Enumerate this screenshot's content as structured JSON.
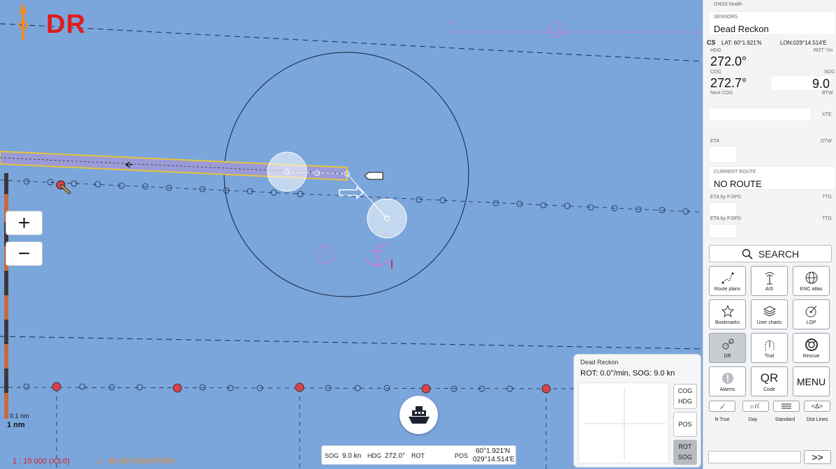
{
  "map": {
    "mode_label": "DR",
    "zoom_in": "+",
    "zoom_out": "−",
    "scale_small": "0.1 nm",
    "scale_big": "1 nm",
    "scale_ratio_main": "1 : 15 000 (X3.0)",
    "scale_ratio_chart": "1 : 45 000  RU4NTKR9",
    "colors": {
      "sea": "#7aa6dc",
      "dr_red": "#e01c1c",
      "orange": "#f08a22",
      "magenta": "#c77ad8",
      "route_fill": "#9a9bd8",
      "route_edge": "#e6c33a"
    }
  },
  "nav_strip": {
    "sog_label": "SOG",
    "sog_value": "9.0 kn",
    "hdg_label": "HDG",
    "hdg_value": "272.0°",
    "rot_label": "ROT",
    "rot_value": "",
    "pos_label": "POS",
    "pos_lat": "60°1.921'N",
    "pos_lon": "029°14.514'E"
  },
  "dr_panel": {
    "title": "Dead Reckon",
    "info": "ROT: 0.0°/min, SOG: 9.0 kn",
    "btn_cog": "COG",
    "btn_hdg": "HDG",
    "btn_pos": "POS",
    "btn_rot": "ROT",
    "btn_sog": "SOG"
  },
  "panel": {
    "gnss": "GNSS health",
    "sensors_label": "SENSORS",
    "sensor_value": "Dead Reckon",
    "cs": "CS",
    "lat": "LAT: 60°1.921'N",
    "lon": "LON:029°14.514'E",
    "hdg_label": "HDG",
    "hdg_value": "272.0°",
    "rot_label": "ROT °/m",
    "cog_label": "COG",
    "cog_value": "272.7°",
    "sog_label": "SOG",
    "sog_value": "9.0",
    "next_cog": "Next COG",
    "btw": "BTW",
    "xte": "XTE",
    "eta": "ETA",
    "dtw": "DTW",
    "current_route_label": "CURRENT ROUTE",
    "current_route_value": "NO ROUTE",
    "eta_pspd_1": "ETA by P.SPD",
    "ttg_1": "TTG",
    "eta_pspd_2": "ETA by P.SPD",
    "ttg_2": "TTG",
    "search": "SEARCH",
    "buttons": [
      {
        "label": "Route plans"
      },
      {
        "label": "AIS"
      },
      {
        "label": "ENC atlas"
      },
      {
        "label": "Bookmarks"
      },
      {
        "label": "User charts"
      },
      {
        "label": "LOP"
      },
      {
        "label": "DR"
      },
      {
        "label": "Trial"
      },
      {
        "label": "Rescue"
      },
      {
        "label": "Alarms"
      },
      {
        "label": "Code",
        "glyph": "QR"
      },
      {
        "label": "MENU"
      }
    ],
    "small_buttons": [
      {
        "label": "N True"
      },
      {
        "label": "Day",
        "glyph": "☼/☾"
      },
      {
        "label": "Standard"
      },
      {
        "label": "Dist Lines",
        "glyph": "<Δ>"
      }
    ],
    "next_glyph": ">>"
  }
}
